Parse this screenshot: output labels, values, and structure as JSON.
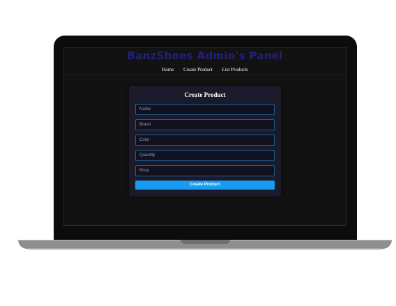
{
  "header": {
    "title": "BanzShoes Admin's Panel"
  },
  "nav": {
    "items": [
      "Home",
      "Create Product",
      "List Products"
    ]
  },
  "form": {
    "title": "Create Product",
    "fields": [
      {
        "placeholder": "Name"
      },
      {
        "placeholder": "Brand"
      },
      {
        "placeholder": "Color"
      },
      {
        "placeholder": "Quantity"
      },
      {
        "placeholder": "Price"
      }
    ],
    "submit_label": "Create Product"
  },
  "colors": {
    "brand": "#23207a",
    "accent": "#1a9bf2",
    "field_border": "#1f5f8e"
  }
}
